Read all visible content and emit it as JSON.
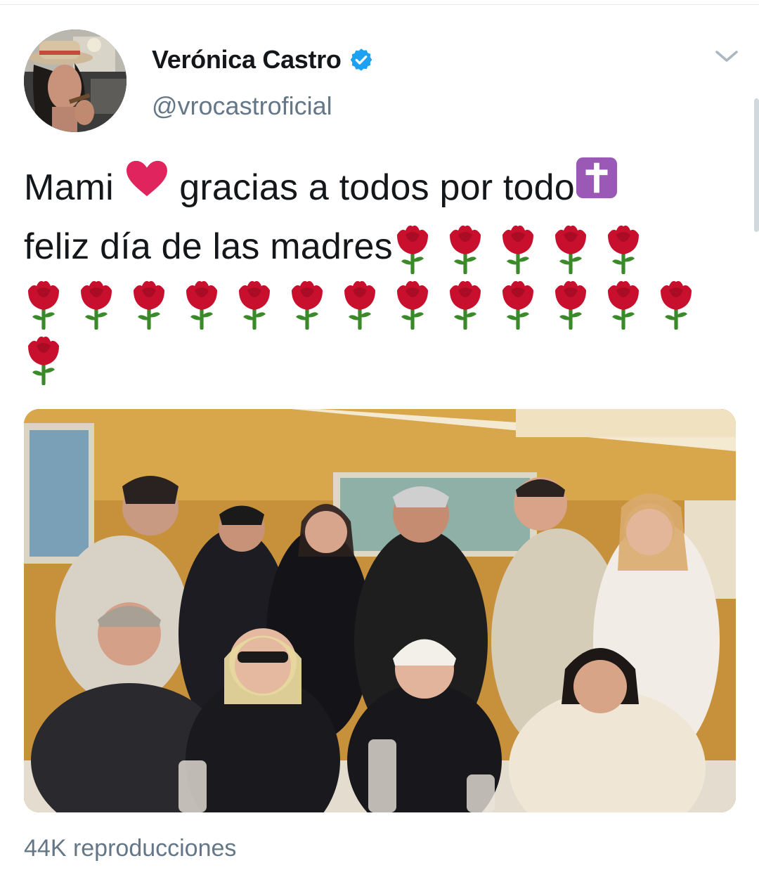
{
  "tweet": {
    "author": {
      "display_name": "Verónica Castro",
      "handle": "@vrocastroficial",
      "verified": true,
      "verified_icon": "verified-badge-icon",
      "verified_color": "#1da1f2"
    },
    "text_segments": {
      "line1_a": "Mami ",
      "heart_icon": "red-heart-icon",
      "line1_b": " gracias a todos por todo",
      "cross_icon": "latin-cross-icon",
      "line2": "feliz día de las madres"
    },
    "rose_icon": "rose-icon",
    "rose_count": 19,
    "media": {
      "type": "video",
      "description_icon": "group-photo-video"
    },
    "views": "44K reproducciones",
    "menu_icon": "chevron-down-icon"
  },
  "colors": {
    "text_primary": "#14171a",
    "text_secondary": "#657786",
    "heart": "#e0245e",
    "cross_bg": "#9b59b6",
    "rose_petal": "#c8102e",
    "rose_stem": "#3a8a2a"
  }
}
